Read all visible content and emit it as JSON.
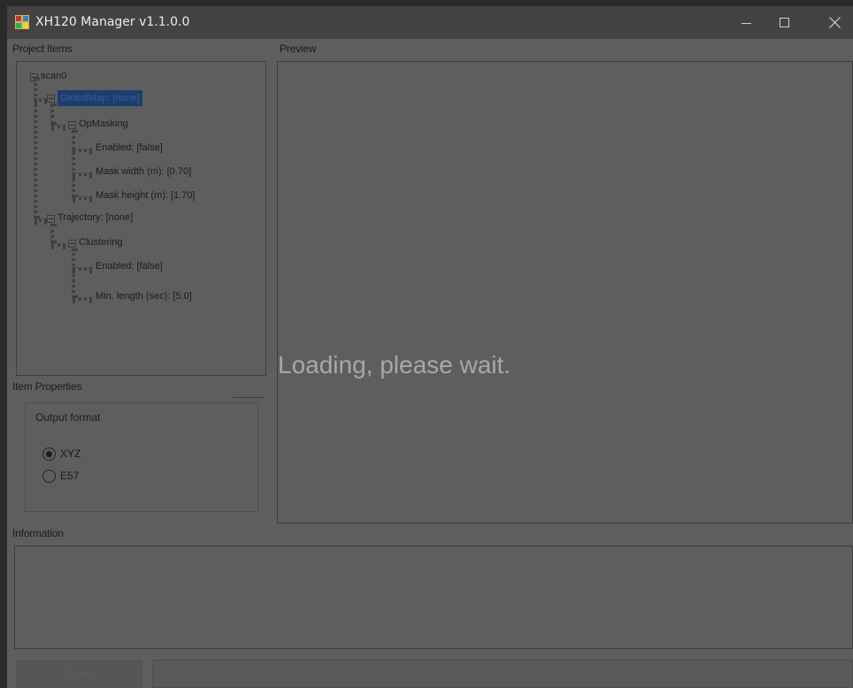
{
  "window": {
    "title": "XH120 Manager v1.1.0.0",
    "colors": {
      "titlebar": "#434343",
      "body": "#5e5e5e",
      "selection": "#1a3e6e",
      "loading_text": "#a8a8a8"
    }
  },
  "project_items": {
    "label": "Project Items",
    "tree": {
      "root": "scan0",
      "global_map": "GlobalMap: [none]",
      "op_masking": "OpMasking",
      "op_masking_enabled": "Enabled: [false]",
      "mask_width": "Mask width (m): [0.70]",
      "mask_height": "Mask height (m): [1.70]",
      "trajectory": "Trajectory: [none]",
      "clustering": "Clustering",
      "clustering_enabled": "Enabled: [false]",
      "min_length": "Min. length (sec): [5.0]"
    }
  },
  "preview": {
    "label": "Preview",
    "loading_text": "Loading, please wait."
  },
  "item_properties": {
    "label": "Item Properties",
    "output_format": {
      "legend": "Output format",
      "options": [
        "XYZ",
        "E57"
      ],
      "selected": "XYZ"
    }
  },
  "information": {
    "label": "Information",
    "text": ""
  },
  "footer": {
    "export_label": "Export",
    "status_text": ""
  },
  "icons": [
    "app-icon",
    "minimize-icon",
    "maximize-icon",
    "close-icon",
    "tree-collapse-icon",
    "radio-checked-icon",
    "radio-unchecked-icon"
  ]
}
